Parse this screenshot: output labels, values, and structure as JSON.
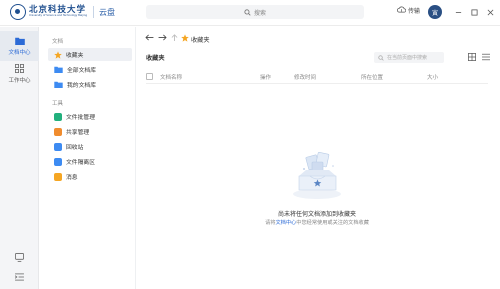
{
  "header": {
    "logo_cn": "北京科技大学",
    "logo_en": "University of Science and Technology Beijing",
    "app_name": "云盘",
    "search_placeholder": "搜索",
    "transfer_label": "传输",
    "avatar_text": "寅"
  },
  "rail": {
    "items": [
      {
        "label": "文档中心",
        "icon": "folder-icon",
        "active": true
      },
      {
        "label": "工作中心",
        "icon": "grid-icon",
        "active": false
      }
    ]
  },
  "sidebar": {
    "section_docs": "文档",
    "section_tools": "工具",
    "docs": [
      {
        "label": "收藏夹",
        "icon": "star-icon",
        "color": "#f5a623",
        "active": true
      },
      {
        "label": "全部文档库",
        "icon": "folder-icon",
        "color": "#3d8bf2",
        "active": false
      },
      {
        "label": "我的文档库",
        "icon": "folder-icon",
        "color": "#3d8bf2",
        "active": false
      }
    ],
    "tools": [
      {
        "label": "文件批管理",
        "icon": "batch-icon",
        "color": "#22b07d"
      },
      {
        "label": "共享管理",
        "icon": "share-icon",
        "color": "#f08c2e"
      },
      {
        "label": "回收站",
        "icon": "recycle-icon",
        "color": "#3d8bf2"
      },
      {
        "label": "文件隔离区",
        "icon": "quarantine-icon",
        "color": "#3d8bf2"
      },
      {
        "label": "消息",
        "icon": "message-icon",
        "color": "#f5a623"
      }
    ]
  },
  "main": {
    "breadcrumb": "收藏夹",
    "title": "收藏夹",
    "filter_placeholder": "在当前页面中搜索",
    "columns": [
      "文档名称",
      "操作",
      "修改时间",
      "所在位置",
      "大小"
    ],
    "empty_title": "尚未将任何文档添加到收藏夹",
    "empty_sub_prefix": "请将",
    "empty_sub_link": "文档中心",
    "empty_sub_suffix": "中您经常使用或关注的文档收藏"
  }
}
